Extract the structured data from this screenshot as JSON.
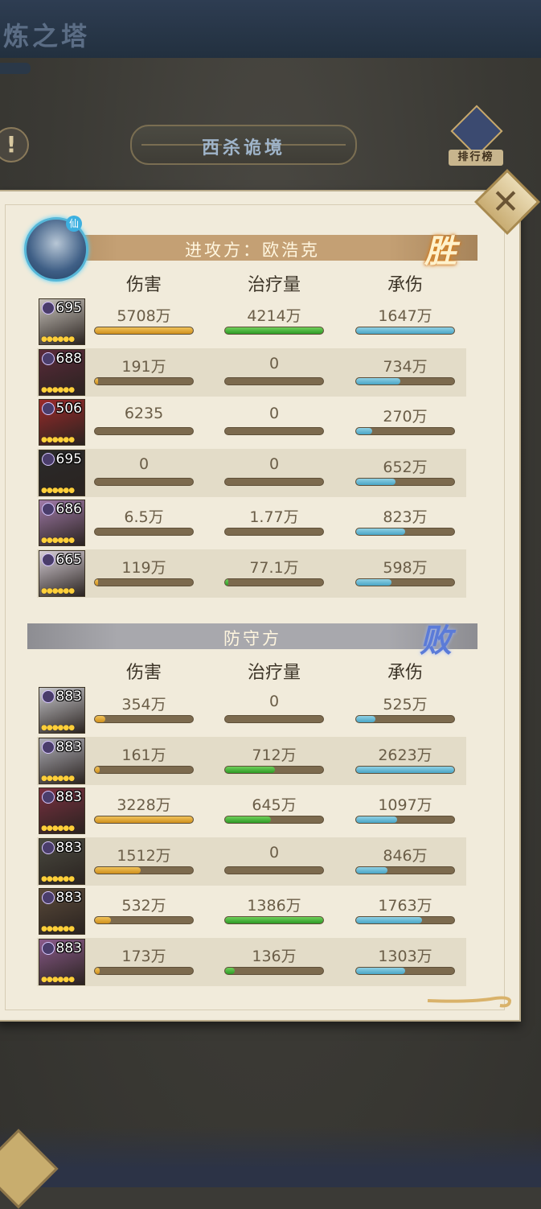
{
  "title": "炼之塔",
  "zone_name": "西杀诡境",
  "rank_label": "排行榜",
  "info_label": "!",
  "close_label": "✕",
  "columns": {
    "damage": "伤害",
    "healing": "治疗量",
    "tank": "承伤"
  },
  "attacker": {
    "team_label": "进攻方：欧浩克",
    "result": "胜",
    "leader_badge": "仙",
    "heroes": [
      {
        "level": "695",
        "damage": "5708万",
        "damage_pct": 100,
        "healing": "4214万",
        "healing_pct": 100,
        "tank": "1647万",
        "tank_pct": 100
      },
      {
        "level": "688",
        "damage": "191万",
        "damage_pct": 3,
        "healing": "0",
        "healing_pct": 0,
        "tank": "734万",
        "tank_pct": 45
      },
      {
        "level": "506",
        "damage": "6235",
        "damage_pct": 0,
        "healing": "0",
        "healing_pct": 0,
        "tank": "270万",
        "tank_pct": 16
      },
      {
        "level": "695",
        "damage": "0",
        "damage_pct": 0,
        "healing": "0",
        "healing_pct": 0,
        "tank": "652万",
        "tank_pct": 40
      },
      {
        "level": "686",
        "damage": "6.5万",
        "damage_pct": 0,
        "healing": "1.77万",
        "healing_pct": 0,
        "tank": "823万",
        "tank_pct": 50
      },
      {
        "level": "665",
        "damage": "119万",
        "damage_pct": 2,
        "healing": "77.1万",
        "healing_pct": 2,
        "tank": "598万",
        "tank_pct": 36
      }
    ]
  },
  "defender": {
    "team_label": "防守方",
    "result": "败",
    "heroes": [
      {
        "level": "883",
        "damage": "354万",
        "damage_pct": 11,
        "healing": "0",
        "healing_pct": 0,
        "tank": "525万",
        "tank_pct": 20
      },
      {
        "level": "883",
        "damage": "161万",
        "damage_pct": 5,
        "healing": "712万",
        "healing_pct": 51,
        "tank": "2623万",
        "tank_pct": 100
      },
      {
        "level": "883",
        "damage": "3228万",
        "damage_pct": 100,
        "healing": "645万",
        "healing_pct": 47,
        "tank": "1097万",
        "tank_pct": 42
      },
      {
        "level": "883",
        "damage": "1512万",
        "damage_pct": 47,
        "healing": "0",
        "healing_pct": 0,
        "tank": "846万",
        "tank_pct": 32
      },
      {
        "level": "883",
        "damage": "532万",
        "damage_pct": 16,
        "healing": "1386万",
        "healing_pct": 100,
        "tank": "1763万",
        "tank_pct": 67
      },
      {
        "level": "883",
        "damage": "173万",
        "damage_pct": 5,
        "healing": "136万",
        "healing_pct": 10,
        "tank": "1303万",
        "tank_pct": 50
      }
    ]
  },
  "colors": {
    "damage": "#e0a83a",
    "healing": "#3fb033",
    "tank": "#5ab3d2",
    "win": "#e08a1e",
    "lose": "#5b7bd8"
  }
}
